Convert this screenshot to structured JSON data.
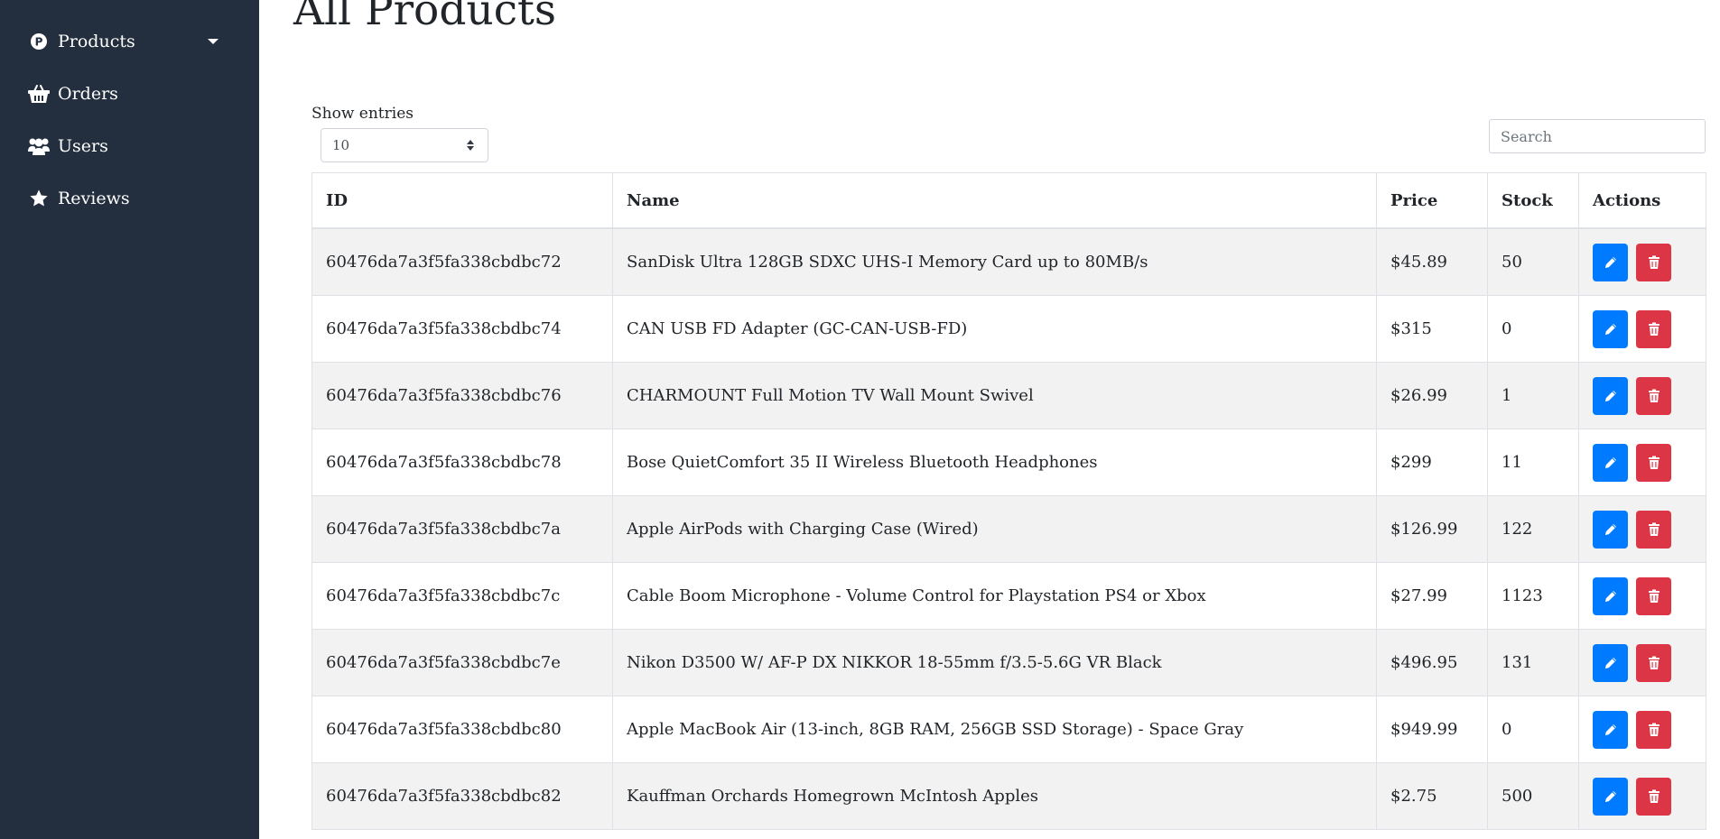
{
  "sidebar": {
    "items": [
      {
        "label": "Products",
        "icon": "product-hunt-icon",
        "has_dropdown": true
      },
      {
        "label": "Orders",
        "icon": "basket-icon"
      },
      {
        "label": "Users",
        "icon": "users-icon"
      },
      {
        "label": "Reviews",
        "icon": "star-icon"
      }
    ],
    "background": "#232f3e"
  },
  "main": {
    "title": "All Products",
    "entries_label": "Show entries",
    "entries_value": "10",
    "search_placeholder": "Search"
  },
  "table": {
    "headers": [
      "ID",
      "Name",
      "Price",
      "Stock",
      "Actions"
    ],
    "rows": [
      {
        "id": "60476da7a3f5fa338cbdbc72",
        "name": "SanDisk Ultra 128GB SDXC UHS-I Memory Card up to 80MB/s",
        "price": "$45.89",
        "stock": "50"
      },
      {
        "id": "60476da7a3f5fa338cbdbc74",
        "name": "CAN USB FD Adapter (GC-CAN-USB-FD)",
        "price": "$315",
        "stock": "0"
      },
      {
        "id": "60476da7a3f5fa338cbdbc76",
        "name": "CHARMOUNT Full Motion TV Wall Mount Swivel",
        "price": "$26.99",
        "stock": "1"
      },
      {
        "id": "60476da7a3f5fa338cbdbc78",
        "name": "Bose QuietComfort 35 II Wireless Bluetooth Headphones",
        "price": "$299",
        "stock": "11"
      },
      {
        "id": "60476da7a3f5fa338cbdbc7a",
        "name": "Apple AirPods with Charging Case (Wired)",
        "price": "$126.99",
        "stock": "122"
      },
      {
        "id": "60476da7a3f5fa338cbdbc7c",
        "name": "Cable Boom Microphone - Volume Control for Playstation PS4 or Xbox",
        "price": "$27.99",
        "stock": "1123"
      },
      {
        "id": "60476da7a3f5fa338cbdbc7e",
        "name": "Nikon D3500 W/ AF-P DX NIKKOR 18-55mm f/3.5-5.6G VR Black",
        "price": "$496.95",
        "stock": "131"
      },
      {
        "id": "60476da7a3f5fa338cbdbc80",
        "name": "Apple MacBook Air (13-inch, 8GB RAM, 256GB SSD Storage) - Space Gray",
        "price": "$949.99",
        "stock": "0"
      },
      {
        "id": "60476da7a3f5fa338cbdbc82",
        "name": "Kauffman Orchards Homegrown McIntosh Apples",
        "price": "$2.75",
        "stock": "500"
      }
    ],
    "actions": {
      "edit_icon": "pencil-icon",
      "delete_icon": "trash-icon",
      "edit_color": "#007bff",
      "delete_color": "#dc3545"
    }
  }
}
